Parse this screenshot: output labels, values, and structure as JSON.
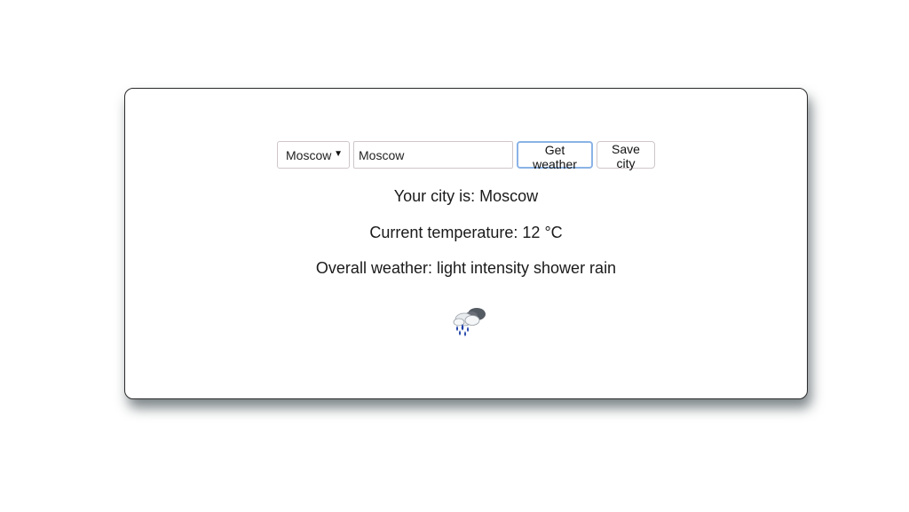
{
  "controls": {
    "selected_city": "Moscow",
    "city_input_value": "Moscow",
    "get_weather_label": "Get weather",
    "save_city_label": "Save city"
  },
  "info": {
    "city_line": "Your city is: Moscow",
    "temperature_line": "Current temperature: 12 °C",
    "weather_line": "Overall weather: light intensity shower rain"
  },
  "icons": {
    "select_arrow": "dropdown-arrow-icon",
    "weather": "shower-rain-icon"
  }
}
